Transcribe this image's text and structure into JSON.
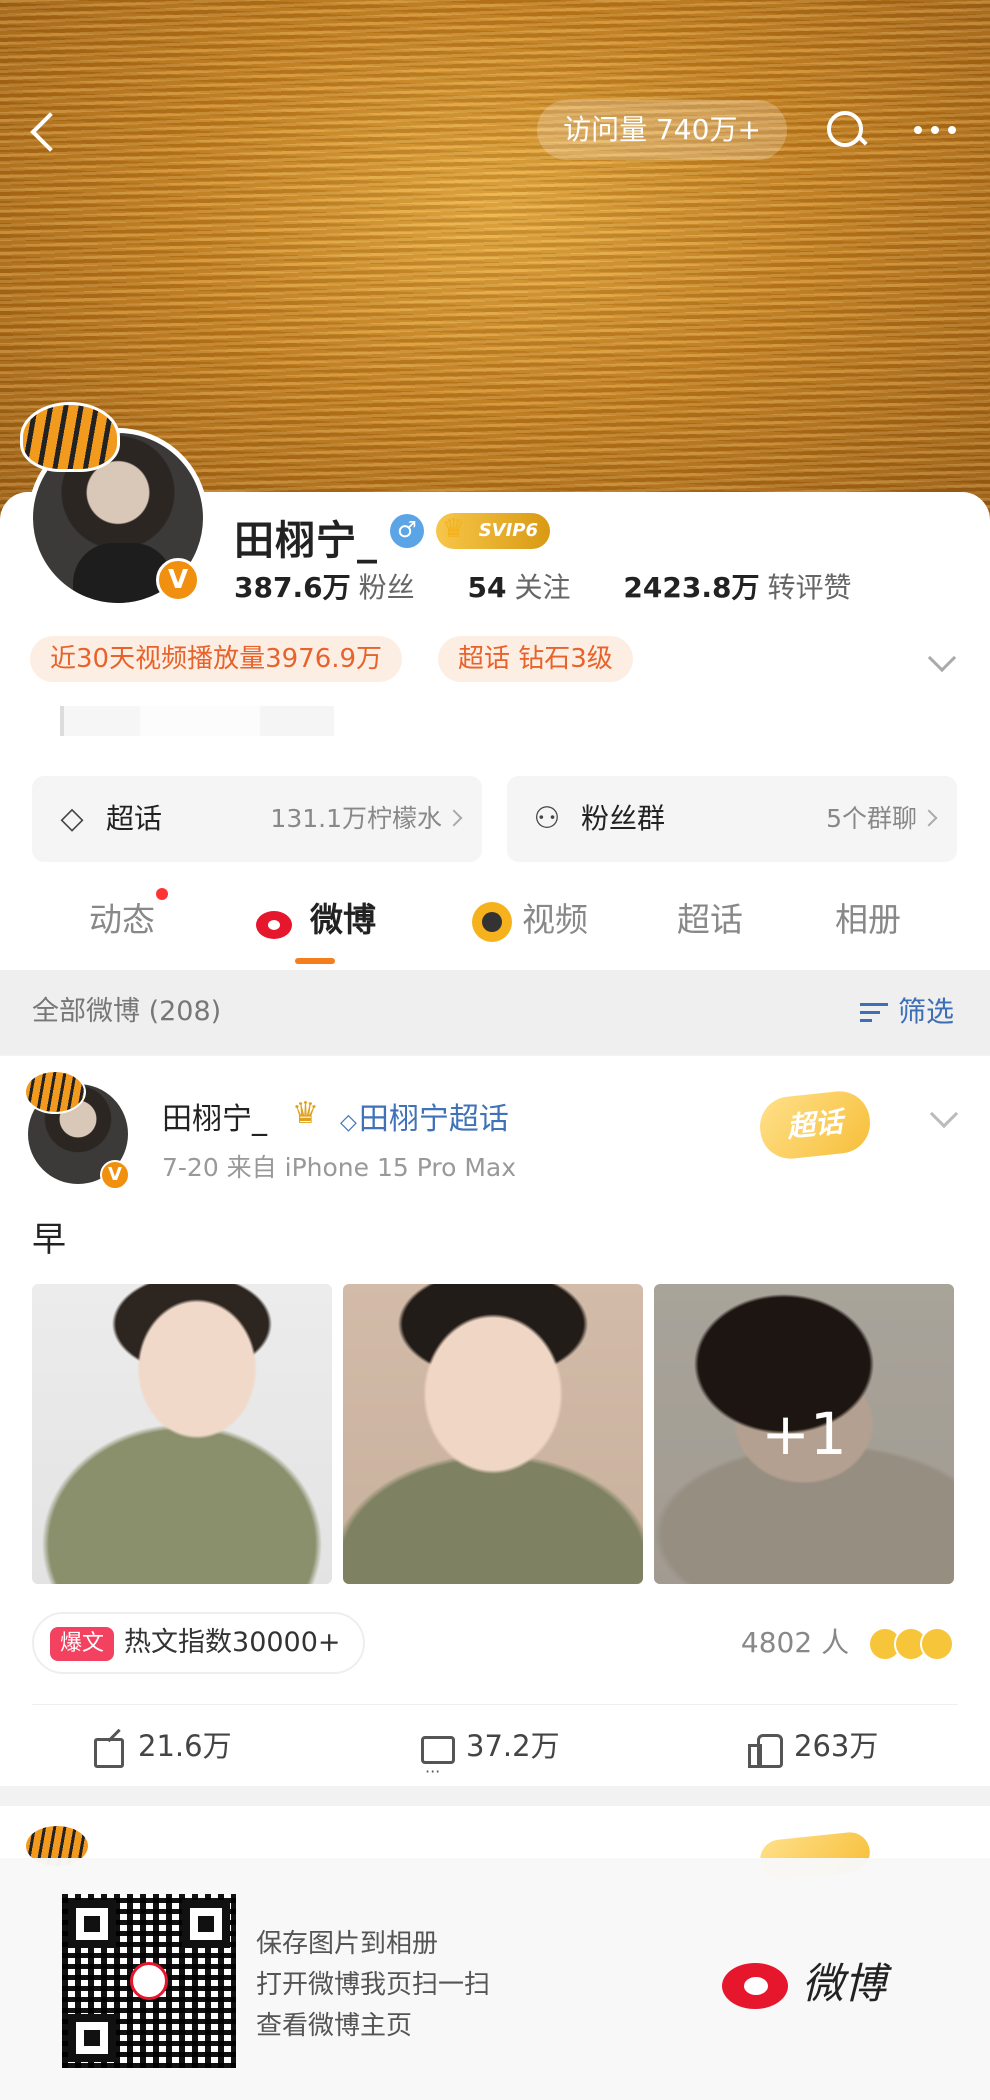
{
  "header": {
    "visits": "访问量 740万+",
    "icons": {
      "back": "back-arrow-icon",
      "search": "search-icon",
      "more": "more-dots-icon"
    }
  },
  "profile": {
    "name": "田栩宁_",
    "gender_icon": "male-icon",
    "vip": "SVIP6",
    "verified_badge": "V",
    "stats": [
      {
        "value": "387.6万",
        "label": "粉丝"
      },
      {
        "value": "54",
        "label": "关注"
      },
      {
        "value": "2423.8万",
        "label": "转评赞"
      }
    ],
    "tags": [
      "近30天视频播放量3976.9万",
      "超话 钻石3级"
    ]
  },
  "entries": [
    {
      "label": "超话",
      "meta": "131.1万柠檬水",
      "icon": "diamond-icon"
    },
    {
      "label": "粉丝群",
      "meta": "5个群聊",
      "icon": "group-icon"
    }
  ],
  "tabs": [
    {
      "label": "动态",
      "has_dot": true
    },
    {
      "label": "微博",
      "active": true
    },
    {
      "label": "视频"
    },
    {
      "label": "超话"
    },
    {
      "label": "相册"
    }
  ],
  "feed": {
    "count_label": "全部微博 (208)",
    "filter_label": "筛选"
  },
  "post": {
    "author": "田栩宁_",
    "topic": "田栩宁超话",
    "stamp": "超话",
    "meta": "7-20  来自 iPhone 15 Pro Max",
    "text": "早",
    "more_photos": "+1",
    "hot_badge": "爆文",
    "hot_label": "热文指数30000+",
    "reactions_label": "4802 人",
    "actions": {
      "repost": "21.6万",
      "comment": "37.2万",
      "like": "263万"
    }
  },
  "share_overlay": {
    "lines": [
      "保存图片到相册",
      "打开微博我页扫一扫",
      "查看微博主页"
    ],
    "brand": "微博"
  },
  "colors": {
    "accent": "#f47d1c",
    "link": "#3f72b8",
    "tag_bg": "#fdeee4",
    "tag_text": "#e8632b",
    "weibo_red": "#e6162d"
  }
}
